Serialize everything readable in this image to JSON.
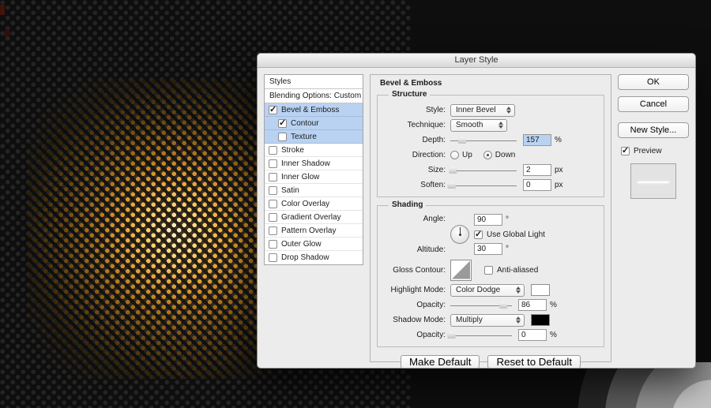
{
  "colors": {
    "selection": "#b9d2f2",
    "highlight_swatch": "#ffffff",
    "shadow_swatch": "#000000"
  },
  "dialog": {
    "title": "Layer Style"
  },
  "styles_panel": {
    "header": "Styles",
    "blending_options": "Blending Options: Custom",
    "items": [
      {
        "label": "Bevel & Emboss",
        "checked": true,
        "selected": true,
        "indent": false
      },
      {
        "label": "Contour",
        "checked": true,
        "selected": true,
        "indent": true
      },
      {
        "label": "Texture",
        "checked": false,
        "selected": true,
        "indent": true
      },
      {
        "label": "Stroke",
        "checked": false,
        "selected": false,
        "indent": false
      },
      {
        "label": "Inner Shadow",
        "checked": false,
        "selected": false,
        "indent": false
      },
      {
        "label": "Inner Glow",
        "checked": false,
        "selected": false,
        "indent": false
      },
      {
        "label": "Satin",
        "checked": false,
        "selected": false,
        "indent": false
      },
      {
        "label": "Color Overlay",
        "checked": false,
        "selected": false,
        "indent": false
      },
      {
        "label": "Gradient Overlay",
        "checked": false,
        "selected": false,
        "indent": false
      },
      {
        "label": "Pattern Overlay",
        "checked": false,
        "selected": false,
        "indent": false
      },
      {
        "label": "Outer Glow",
        "checked": false,
        "selected": false,
        "indent": false
      },
      {
        "label": "Drop Shadow",
        "checked": false,
        "selected": false,
        "indent": false
      }
    ]
  },
  "main_panel": {
    "title": "Bevel & Emboss",
    "structure": {
      "legend": "Structure",
      "style": {
        "label": "Style:",
        "value": "Inner Bevel"
      },
      "technique": {
        "label": "Technique:",
        "value": "Smooth"
      },
      "depth": {
        "label": "Depth:",
        "value": "157",
        "unit": "%"
      },
      "direction": {
        "label": "Direction:",
        "options": [
          "Up",
          "Down"
        ],
        "selected": "Down"
      },
      "size": {
        "label": "Size:",
        "value": "2",
        "unit": "px"
      },
      "soften": {
        "label": "Soften:",
        "value": "0",
        "unit": "px"
      }
    },
    "shading": {
      "legend": "Shading",
      "angle": {
        "label": "Angle:",
        "value": "90",
        "unit": "°"
      },
      "use_global_light": {
        "label": "Use Global Light",
        "checked": true
      },
      "altitude": {
        "label": "Altitude:",
        "value": "30",
        "unit": "°"
      },
      "gloss_contour": {
        "label": "Gloss Contour:"
      },
      "anti_aliased": {
        "label": "Anti-aliased",
        "checked": false
      },
      "highlight_mode": {
        "label": "Highlight Mode:",
        "value": "Color Dodge"
      },
      "opacity_highlight": {
        "label": "Opacity:",
        "value": "86",
        "unit": "%"
      },
      "shadow_mode": {
        "label": "Shadow Mode:",
        "value": "Multiply"
      },
      "opacity_shadow": {
        "label": "Opacity:",
        "value": "0",
        "unit": "%"
      }
    },
    "footer": {
      "make_default": "Make Default",
      "reset_to_default": "Reset to Default"
    }
  },
  "action_buttons": {
    "ok": "OK",
    "cancel": "Cancel",
    "new_style": "New Style...",
    "preview": "Preview",
    "preview_checked": true
  },
  "slider_positions": {
    "depth": 18,
    "size": 4,
    "soften": 2,
    "opacity_highlight": 86,
    "opacity_shadow": 2
  }
}
